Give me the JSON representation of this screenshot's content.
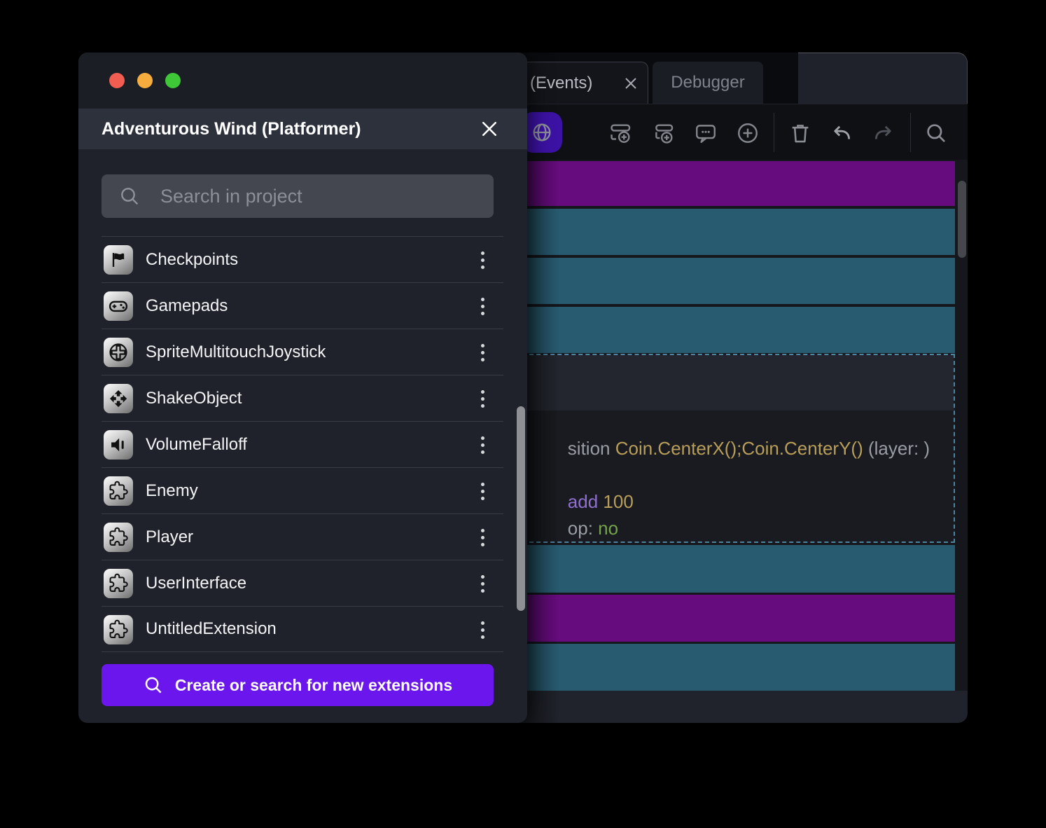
{
  "dialog": {
    "title": "Adventurous Wind (Platformer)",
    "search_placeholder": "Search in project",
    "items": [
      {
        "label": "Checkpoints",
        "icon": "flag-icon"
      },
      {
        "label": "Gamepads",
        "icon": "gamepad-icon"
      },
      {
        "label": "SpriteMultitouchJoystick",
        "icon": "joystick-icon"
      },
      {
        "label": "ShakeObject",
        "icon": "move-arrows-icon"
      },
      {
        "label": "VolumeFalloff",
        "icon": "speaker-icon"
      },
      {
        "label": "Enemy",
        "icon": "puzzle-icon"
      },
      {
        "label": "Player",
        "icon": "puzzle-icon"
      },
      {
        "label": "UserInterface",
        "icon": "puzzle-icon"
      },
      {
        "label": "UntitledExtension",
        "icon": "puzzle-icon"
      }
    ],
    "create_button_label": "Create or search for new extensions"
  },
  "editor": {
    "tabs": {
      "events_label": "(Events)",
      "debugger_label": "Debugger"
    },
    "header_icons": [
      "chevron-down-icon",
      "extensions-puzzle-icon",
      "kebab-menu-icon"
    ],
    "toolbar_icons": [
      "globe-icon",
      "add-event-icon",
      "add-sub-event-icon",
      "add-comment-icon",
      "add-circle-icon",
      "trash-icon",
      "undo-icon",
      "redo-icon",
      "search-icon"
    ],
    "code": {
      "l1_pre": "sition ",
      "l1_expr": "Coin.CenterX();Coin.CenterY()",
      "l1_post": " (layer: )",
      "l2_key": "add",
      "l2_val": " 100",
      "l3_key": "op: ",
      "l3_val": "no"
    }
  },
  "colors": {
    "event_standard": "#285b70",
    "event_comment": "#670c7e",
    "selection_dash": "#4f84a0",
    "accent_purple": "#6a16ec",
    "toolbar_accent": "#3c12a4",
    "expression_gold": "#b89e58",
    "keyword_purple": "#8f6fd0",
    "value_green": "#76a24b"
  }
}
